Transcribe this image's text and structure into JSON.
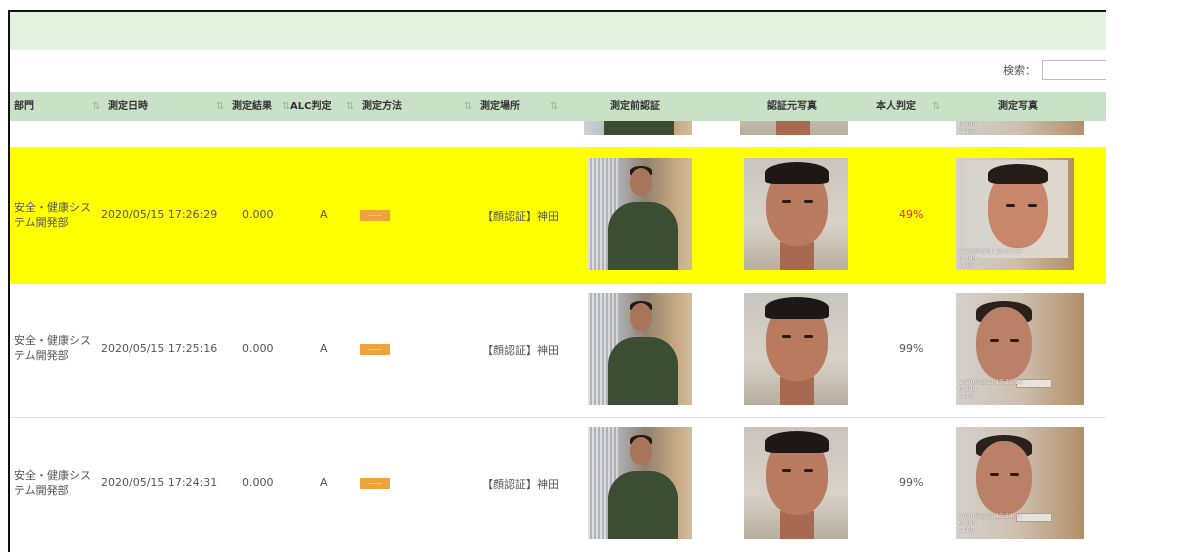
{
  "search": {
    "label": "検索：",
    "value": ""
  },
  "columns": [
    {
      "label": "部門",
      "sort": "⇅"
    },
    {
      "label": "測定日時",
      "sort": "⇅"
    },
    {
      "label": "測定結果",
      "sort": "⇅"
    },
    {
      "label": "ALC判定",
      "sort": "⇅"
    },
    {
      "label": "測定方法",
      "sort": "⇅"
    },
    {
      "label": "測定場所",
      "sort": "⇅"
    },
    {
      "label": "測定前認証",
      "sort": ""
    },
    {
      "label": "認証元写真",
      "sort": ""
    },
    {
      "label": "本人判定",
      "sort": "⇅"
    },
    {
      "label": "測定写真",
      "sort": ""
    }
  ],
  "sliver_overlay": [
    "0.000",
    "1105"
  ],
  "rows": [
    {
      "highlighted": true,
      "dept": "安全・健康システム開発部",
      "datetime": "2020/05/15 17:26:29",
      "result": "0.000",
      "alc": "A",
      "place": "【顔認証】神田",
      "match": "49%",
      "match_color": "#e52b2b",
      "overlay": [
        "2020/06/01 20:07:24",
        "0.000",
        "1105"
      ]
    },
    {
      "highlighted": false,
      "dept": "安全・健康システム開発部",
      "datetime": "2020/05/15 17:25:16",
      "result": "0.000",
      "alc": "A",
      "place": "【顔認証】神田",
      "match": "99%",
      "match_color": "#555555",
      "overlay": [
        "2020/05/15 17:25:16",
        "0.000",
        "1105"
      ]
    },
    {
      "highlighted": false,
      "dept": "安全・健康システム開発部",
      "datetime": "2020/05/15 17:24:31",
      "result": "0.000",
      "alc": "A",
      "place": "【顔認証】神田",
      "match": "99%",
      "match_color": "#555555",
      "overlay": [
        "2020/05/15 17:24:31",
        "0.000",
        "1105"
      ]
    }
  ]
}
